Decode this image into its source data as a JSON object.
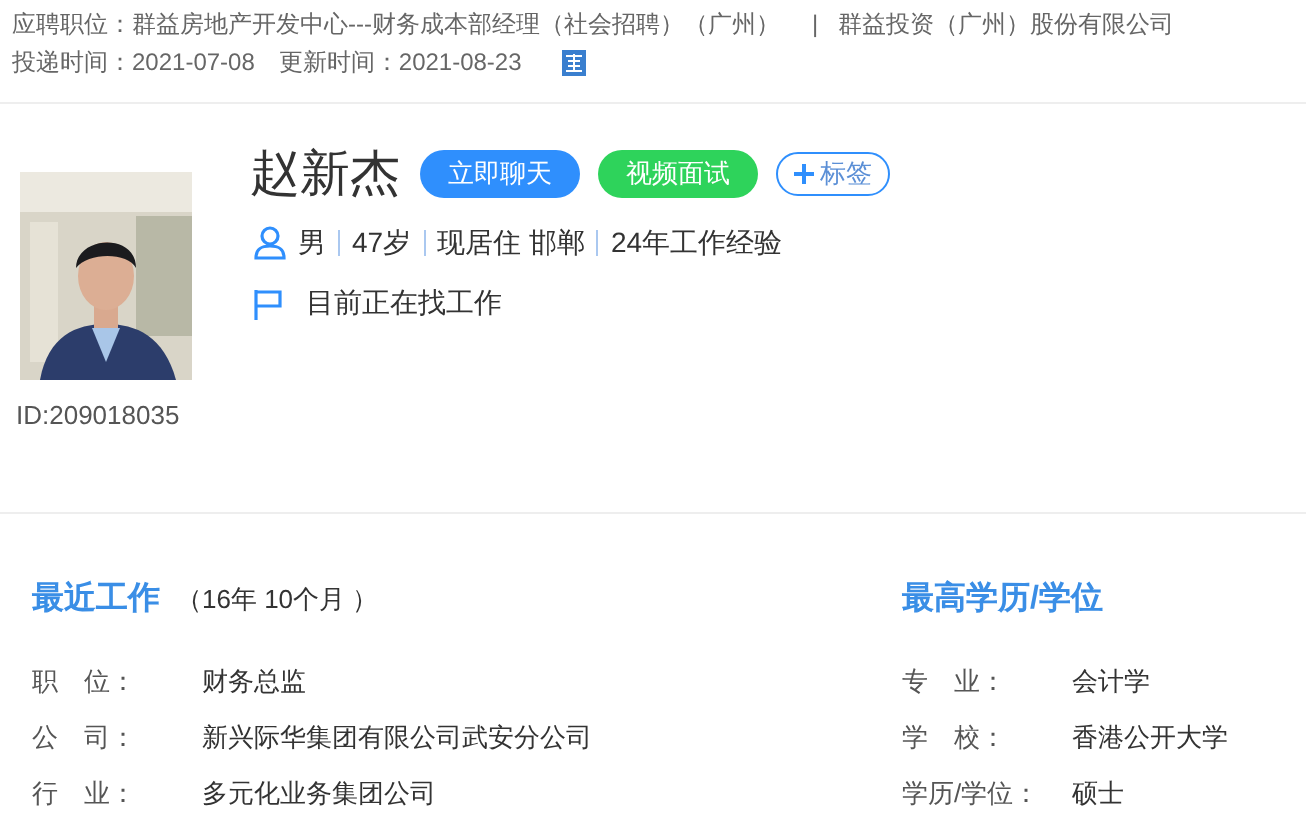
{
  "application": {
    "position_label": "应聘职位：",
    "position": "群益房地产开发中心---财务成本部经理（社会招聘）（广州）",
    "separator": "|",
    "company": "群益投资（广州）股份有限公司",
    "delivered_label": "投递时间：",
    "delivered": "2021-07-08",
    "updated_label": "更新时间：",
    "updated": "2021-08-23"
  },
  "candidate": {
    "id": "ID:209018035",
    "name": "赵新杰",
    "actions": [
      {
        "kind": "primary",
        "label": "立即聊天",
        "color": "#2f8ffd"
      },
      {
        "kind": "primary",
        "label": "视频面试",
        "color": "#2ed35b"
      },
      {
        "kind": "outline",
        "label": "标签"
      }
    ],
    "facts": [
      "男",
      "47岁",
      "现居住 邯郸",
      "24年工作经验"
    ],
    "status": "目前正在找工作"
  },
  "recent_work": {
    "title": "最近工作",
    "duration": "（16年 10个月 ）",
    "rows": [
      {
        "label": "职　位：",
        "value": "财务总监"
      },
      {
        "label": "公　司：",
        "value": "新兴际华集团有限公司武安分公司"
      },
      {
        "label": "行　业：",
        "value": "多元化业务集团公司"
      }
    ]
  },
  "education": {
    "title": "最高学历/学位",
    "rows": [
      {
        "label": "专　业：",
        "value": "会计学"
      },
      {
        "label": "学　校：",
        "value": "香港公开大学"
      },
      {
        "label": "学历/学位：",
        "value": "硕士"
      }
    ]
  }
}
